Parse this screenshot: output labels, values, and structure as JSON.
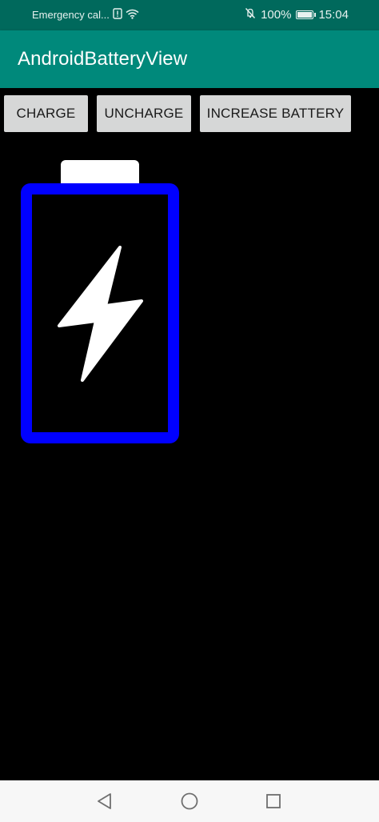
{
  "status_bar": {
    "carrier_text": "Emergency cal...",
    "battery_percent": "100%",
    "time": "15:04",
    "battery_level": 1.0,
    "icons": [
      "alert-icon",
      "wifi-icon",
      "mute-icon",
      "battery-icon"
    ]
  },
  "app_bar": {
    "title": "AndroidBatteryView",
    "color": "#00897b",
    "status_color": "#00695c"
  },
  "buttons": {
    "charge": "CHARGE",
    "uncharge": "UNCHARGE",
    "increase": "INCREASE BATTERY"
  },
  "battery_view": {
    "state": "charging",
    "frame_color": "#0000ff",
    "cap_color": "#ffffff",
    "bolt_color": "#ffffff",
    "icon": "lightning-bolt-icon"
  },
  "nav_bar": {
    "icons": [
      "back-icon",
      "home-icon",
      "recents-icon"
    ]
  }
}
